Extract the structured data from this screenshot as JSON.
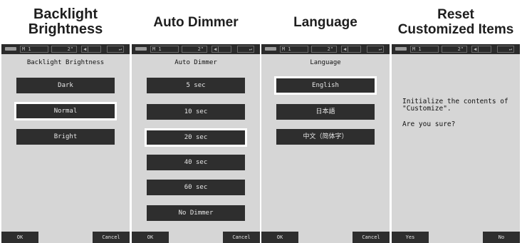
{
  "panels": [
    {
      "heading": "Backlight\nBrightness",
      "status": {
        "mode": "M  1",
        "count": "2\"",
        "icons": "◀|"
      },
      "title": "Backlight Brightness",
      "options": [
        "Dark",
        "Normal",
        "Bright"
      ],
      "selected": "Normal",
      "buttons": {
        "left": "OK",
        "right": "Cancel"
      }
    },
    {
      "heading": "Auto Dimmer",
      "status": {
        "mode": "M  1",
        "count": "2\"",
        "icons": "◀|"
      },
      "title": "Auto Dimmer",
      "options": [
        "5 sec",
        "10 sec",
        "20 sec",
        "40 sec",
        "60 sec",
        "No Dimmer"
      ],
      "selected": "20 sec",
      "buttons": {
        "left": "OK",
        "right": "Cancel"
      }
    },
    {
      "heading": "Language",
      "status": {
        "mode": "M  1",
        "count": "2\"",
        "icons": "◀|"
      },
      "title": "Language",
      "options": [
        "English",
        "日本語",
        "中文（简体字）"
      ],
      "selected": "English",
      "buttons": {
        "left": "OK",
        "right": "Cancel"
      }
    },
    {
      "heading": "Reset\nCustomized Items",
      "status": {
        "mode": "M  1",
        "count": "2\"",
        "icons": "◀|"
      },
      "message": {
        "line1": "Initialize the contents of",
        "line2": "\"Customize\".",
        "line3": "Are you sure?"
      },
      "buttons": {
        "left": "Yes",
        "right": "No"
      }
    }
  ],
  "colors": {
    "screen_bg": "#d6d6d6",
    "button_bg": "#2e2e2e",
    "selected_border": "#ffffff",
    "status_bar": "#2b2b2b"
  }
}
